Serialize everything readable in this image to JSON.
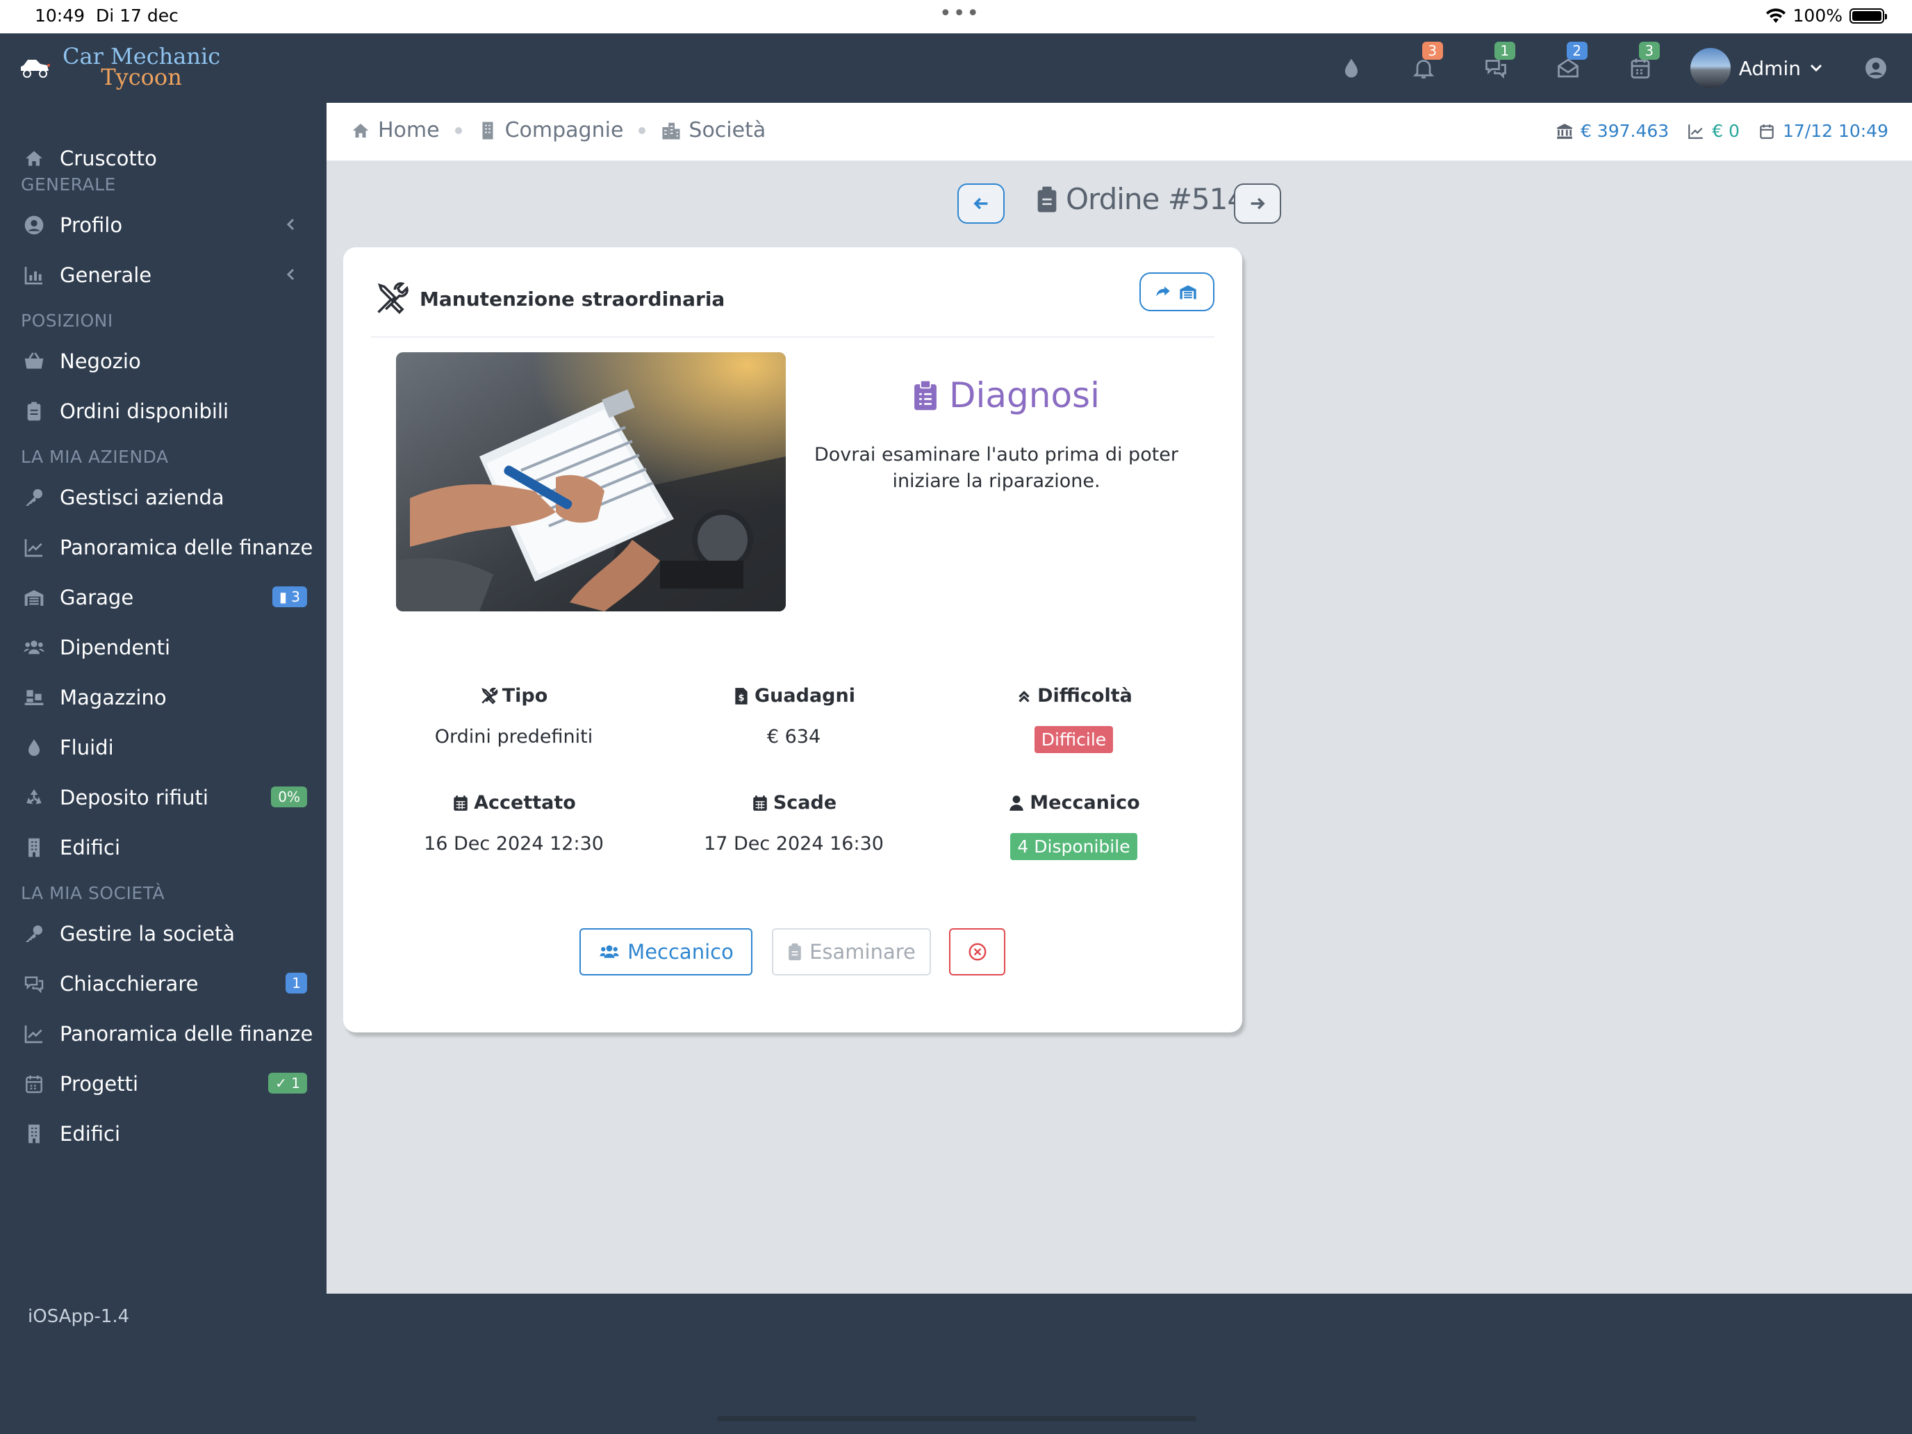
{
  "status_bar": {
    "time": "10:49",
    "date": "Di 17 dec",
    "battery": "100%"
  },
  "app": {
    "logo_line1": "Car Mechanic",
    "logo_line2": "Tycoon"
  },
  "topbar": {
    "badges": {
      "notifications": "3",
      "chat": "1",
      "mail": "2",
      "calendar": "3"
    },
    "user_name": "Admin"
  },
  "colors": {
    "sidebar": "#2f3d4f",
    "accent": "#2f86d0",
    "danger": "#e06470",
    "success": "#56b97a",
    "diagnosis": "#8a6cc2"
  },
  "sidebar": {
    "dashboard": "Cruscotto",
    "section_general": "GENERALE",
    "profile": "Profilo",
    "general": "Generale",
    "section_positions": "POSIZIONI",
    "shop": "Negozio",
    "available_orders": "Ordini disponibili",
    "section_my_company": "LA MIA AZIENDA",
    "manage_company": "Gestisci azienda",
    "finance_overview": "Panoramica delle finanze",
    "garage": "Garage",
    "garage_badge": "3",
    "employees": "Dipendenti",
    "warehouse": "Magazzino",
    "fluids": "Fluidi",
    "waste": "Deposito rifiuti",
    "waste_badge": "0%",
    "buildings": "Edifici",
    "section_my_society": "LA MIA SOCIETÀ",
    "manage_society": "Gestire la società",
    "chat": "Chiacchierare",
    "chat_badge": "1",
    "finance_overview_2": "Panoramica delle finanze",
    "projects": "Progetti",
    "projects_badge": "1",
    "buildings_2": "Edifici",
    "version": "iOSApp-1.4"
  },
  "breadcrumb": {
    "home": "Home",
    "companies": "Compagnie",
    "society": "Società"
  },
  "stats": {
    "bank": "€ 397.463",
    "income": "€ 0",
    "datetime": "17/12 10:49"
  },
  "order": {
    "title": "Ordine #514",
    "card_title": "Manutenzione straordinaria",
    "diagnosis_title": "Diagnosi",
    "diagnosis_text": "Dovrai esaminare l'auto prima di poter iniziare la riparazione.",
    "type_label": "Tipo",
    "type_value": "Ordini predefiniti",
    "earnings_label": "Guadagni",
    "earnings_value": "€ 634",
    "difficulty_label": "Difficoltà",
    "difficulty_value": "Difficile",
    "accepted_label": "Accettato",
    "accepted_value": "16 Dec 2024 12:30",
    "due_label": "Scade",
    "due_value": "17 Dec 2024 16:30",
    "mechanic_label": "Meccanico",
    "mechanic_value": "4 Disponibile",
    "btn_mechanic": "Meccanico",
    "btn_examine": "Esaminare"
  }
}
